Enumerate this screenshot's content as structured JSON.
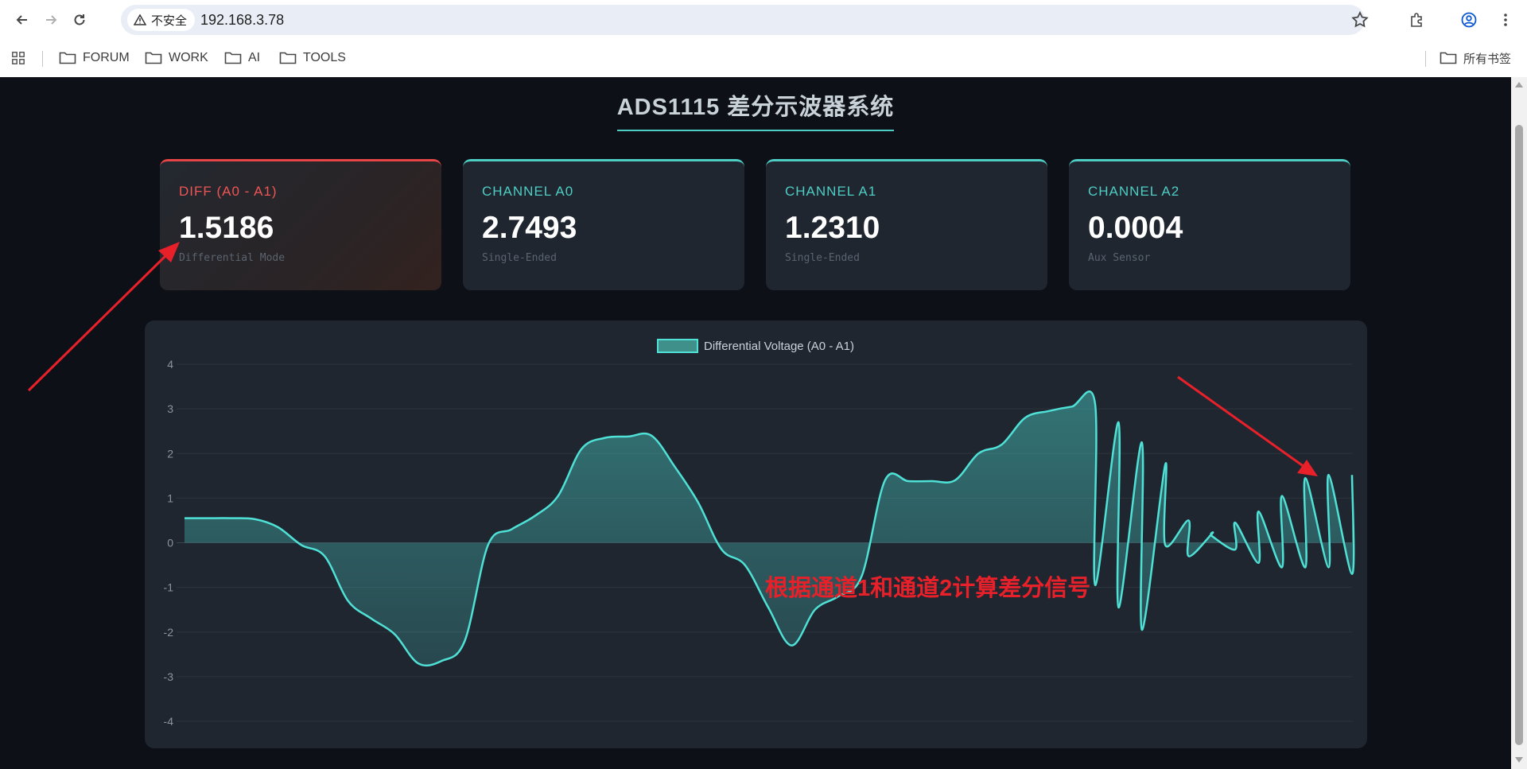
{
  "browser": {
    "security_label": "不安全",
    "url": "192.168.3.78",
    "bookmarks": [
      "FORUM",
      "WORK",
      "AI",
      "TOOLS"
    ],
    "all_bookmarks": "所有书签"
  },
  "page": {
    "title": "ADS1115 差分示波器系统",
    "annotation": "根据通道1和通道2计算差分信号"
  },
  "cards": [
    {
      "label": "DIFF (A0 - A1)",
      "value": "1.5186",
      "sub": "Differential Mode"
    },
    {
      "label": "CHANNEL A0",
      "value": "2.7493",
      "sub": "Single-Ended"
    },
    {
      "label": "CHANNEL A1",
      "value": "1.2310",
      "sub": "Single-Ended"
    },
    {
      "label": "CHANNEL A2",
      "value": "0.0004",
      "sub": "Aux Sensor"
    }
  ],
  "colors": {
    "accent": "#4ecdc4",
    "diff": "#f05555",
    "annotation": "#e8202a"
  },
  "chart_data": {
    "type": "area",
    "series": [
      {
        "name": "Differential Voltage (A0 - A1)",
        "x": [
          0,
          2,
          4,
          6,
          8,
          10,
          12,
          14,
          16,
          18,
          20,
          22,
          24,
          26,
          28,
          30,
          32,
          34,
          36,
          38,
          40,
          42,
          44,
          46,
          48,
          50,
          52,
          54,
          56,
          58,
          60,
          62,
          64,
          66,
          68,
          70,
          72,
          74,
          76,
          78,
          80,
          82,
          84,
          86,
          88,
          90,
          92,
          94,
          96,
          98,
          100
        ],
        "values": [
          0.55,
          0.55,
          0.55,
          0.53,
          0.35,
          -0.05,
          -0.3,
          -1.3,
          -1.7,
          -2.05,
          -2.7,
          -2.65,
          -2.2,
          -0.05,
          0.3,
          0.6,
          1.05,
          2.1,
          2.35,
          2.38,
          2.4,
          1.7,
          0.9,
          -0.15,
          -0.5,
          -1.45,
          -2.3,
          -1.5,
          -1.2,
          -0.75,
          1.4,
          1.38,
          1.38,
          1.4,
          2.0,
          2.2,
          2.8,
          2.95,
          3.05,
          3.1,
          2.7,
          2.25,
          1.75,
          0.5,
          0.2,
          -0.15,
          -0.45,
          -0.55,
          -0.55,
          -0.55,
          -0.7
        ]
      },
      {
        "name": "",
        "x": [
          76,
          78,
          80,
          82,
          84,
          86,
          88,
          90,
          92,
          94,
          96,
          98,
          100
        ],
        "values": [
          -0.7,
          -0.95,
          -1.45,
          -1.95,
          -0.05,
          -0.3,
          0.15,
          0.45,
          0.7,
          1.05,
          1.45,
          1.52,
          1.52
        ]
      }
    ],
    "xlabel": "",
    "ylabel": "",
    "ylim": [
      -4,
      4
    ],
    "yticks": [
      4,
      3,
      2,
      1,
      0,
      -1,
      -2,
      -3,
      -4
    ],
    "grid": true,
    "legend": "top-center",
    "line_color": "#4fe0d6"
  }
}
